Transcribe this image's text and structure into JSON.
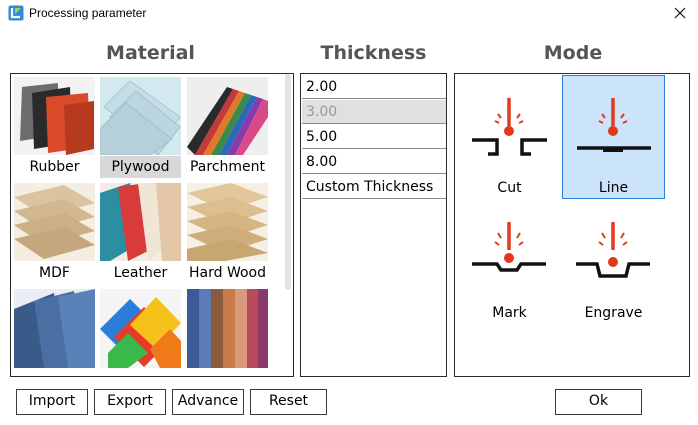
{
  "window": {
    "title": "Processing parameter"
  },
  "headers": {
    "material": "Material",
    "thickness": "Thickness",
    "mode": "Mode"
  },
  "materials": [
    {
      "label": "Rubber",
      "selected": false
    },
    {
      "label": "Plywood",
      "selected": true
    },
    {
      "label": "Parchment",
      "selected": false
    },
    {
      "label": "MDF",
      "selected": false
    },
    {
      "label": "Leather",
      "selected": false
    },
    {
      "label": "Hard Wood",
      "selected": false
    }
  ],
  "thickness": [
    {
      "label": "2.00",
      "selected": false
    },
    {
      "label": "3.00",
      "selected": true
    },
    {
      "label": "5.00",
      "selected": false
    },
    {
      "label": "8.00",
      "selected": false
    },
    {
      "label": "Custom Thickness",
      "selected": false
    }
  ],
  "modes": [
    {
      "label": "Cut",
      "selected": false
    },
    {
      "label": "Line",
      "selected": true
    },
    {
      "label": "Mark",
      "selected": false
    },
    {
      "label": "Engrave",
      "selected": false
    }
  ],
  "buttons": {
    "import": "Import",
    "export": "Export",
    "advance": "Advance",
    "reset": "Reset",
    "ok": "Ok"
  },
  "colors": {
    "laser": "#e2381c",
    "selection_bg": "#cce4fb",
    "selection_border": "#2a7fd8",
    "header_text": "#555555"
  }
}
